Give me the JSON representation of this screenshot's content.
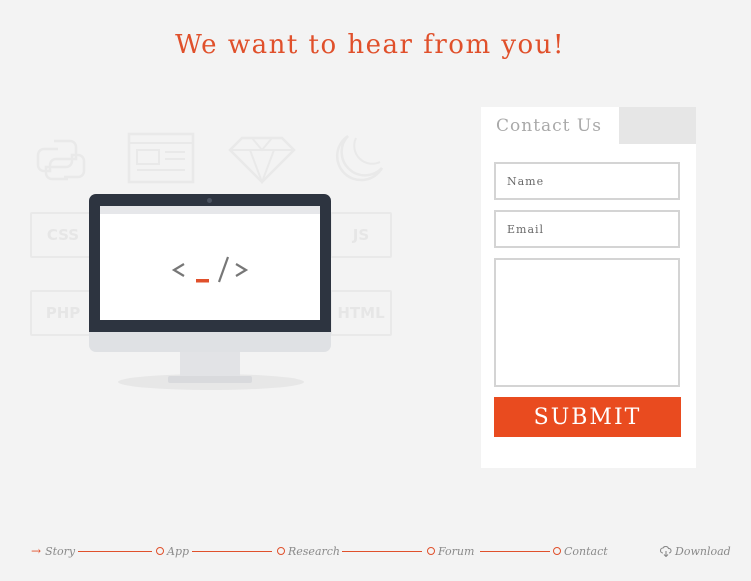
{
  "page": {
    "headline": "We want to hear from you!"
  },
  "background_labels": {
    "css": "CSS",
    "js": "JS",
    "php": "PHP",
    "html": "HTML"
  },
  "contact": {
    "title": "Contact Us",
    "name_placeholder": "Name",
    "email_placeholder": "Email",
    "message_placeholder": "",
    "submit_label": "SUBMIT"
  },
  "nav": {
    "items": [
      {
        "label": "Story",
        "icon": "arrow-right-icon",
        "active": true
      },
      {
        "label": "App",
        "icon": "circle-icon",
        "active": false
      },
      {
        "label": "Research",
        "icon": "circle-icon",
        "active": false
      },
      {
        "label": "Forum",
        "icon": "circle-icon",
        "active": false
      },
      {
        "label": "Contact",
        "icon": "circle-icon",
        "active": false
      },
      {
        "label": "Download",
        "icon": "cloud-download-icon",
        "active": false
      }
    ]
  },
  "colors": {
    "accent": "#e0502b",
    "submit_bg": "#e94b1f",
    "page_bg": "#f3f3f3",
    "monitor_frame": "#2d3440"
  }
}
